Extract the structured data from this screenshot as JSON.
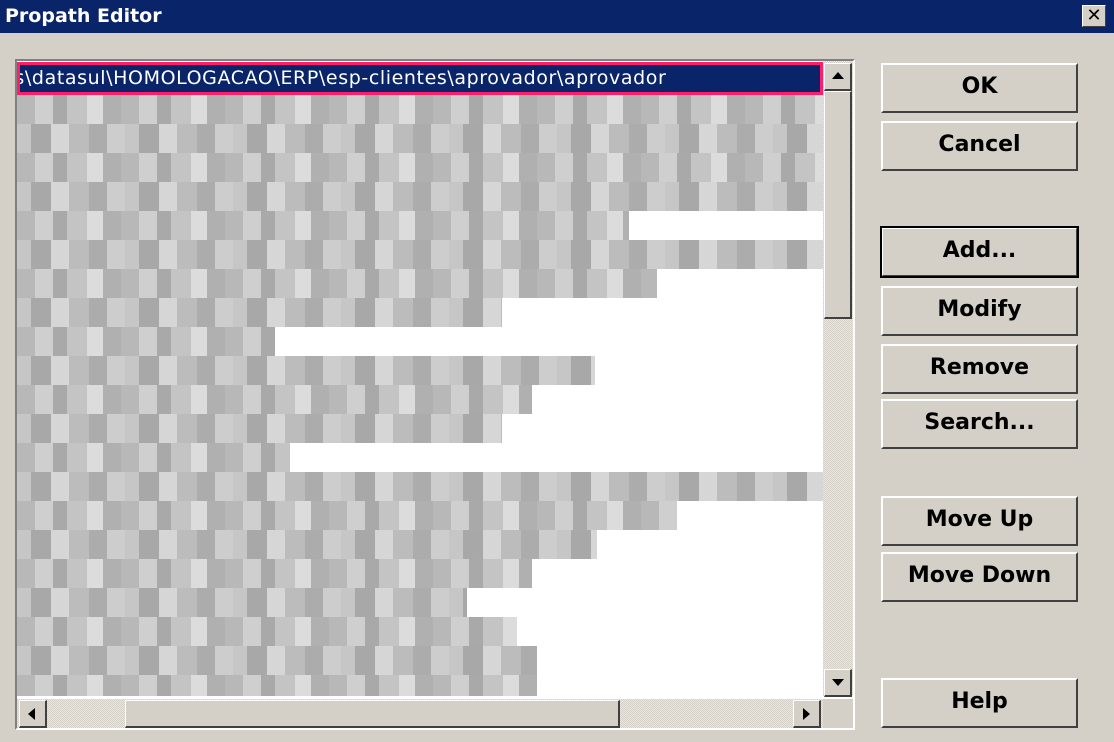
{
  "window": {
    "title": "Propath Editor",
    "close_glyph": "✕"
  },
  "list": {
    "selected_entry": "rs\\datasul\\HOMOLOGACAO\\ERP\\esp-clientes\\aprovador\\aprovador",
    "obscured_rows": 19
  },
  "buttons": {
    "ok": "OK",
    "cancel": "Cancel",
    "add": "Add...",
    "modify": "Modify",
    "remove": "Remove",
    "search": "Search...",
    "move_up": "Move Up",
    "move_down": "Move Down",
    "help": "Help"
  },
  "colors": {
    "title_bar": "#0a246a",
    "selection": "#0a246a",
    "highlight_box": "#ff1e6a",
    "face": "#d4d0c8"
  }
}
